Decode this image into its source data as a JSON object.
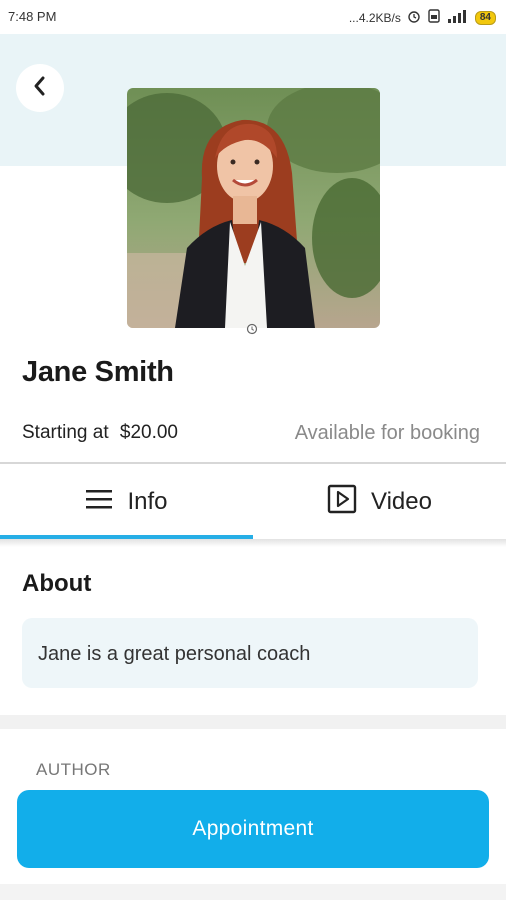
{
  "status_bar": {
    "time": "7:48 PM",
    "network_speed": "...4.2KB/s",
    "battery": "84",
    "icons": [
      "alarm-icon",
      "sim-icon",
      "signal-icon",
      "battery-icon"
    ]
  },
  "header": {
    "back_icon": "chevron-left-icon"
  },
  "profile": {
    "name": "Jane Smith",
    "price_label": "Starting at",
    "price_value": "$20.00",
    "availability": "Available for booking"
  },
  "tabs": [
    {
      "label": "Info",
      "icon": "menu-lines-icon",
      "active": true
    },
    {
      "label": "Video",
      "icon": "play-box-icon",
      "active": false
    }
  ],
  "about": {
    "title": "About",
    "text": "Jane is a great personal coach"
  },
  "author": {
    "label": "AUTHOR"
  },
  "actions": {
    "appointment_label": "Appointment"
  },
  "colors": {
    "accent": "#12aeea",
    "hero_bg": "#e9f4f7",
    "about_bg": "#eef6f9"
  }
}
